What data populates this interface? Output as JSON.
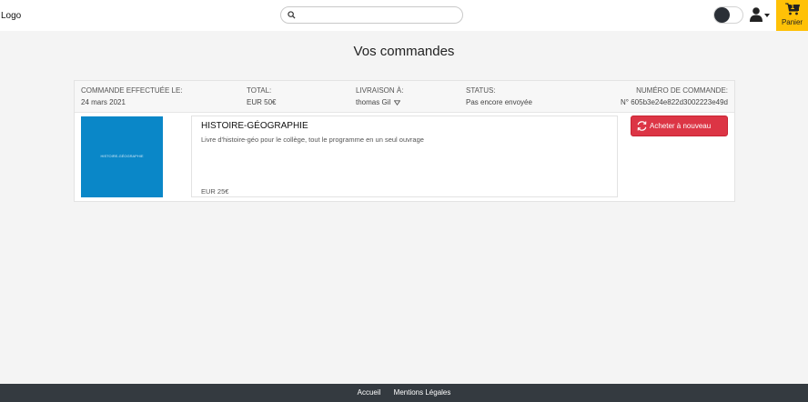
{
  "header": {
    "logo": "Logo",
    "search": {
      "placeholder": "",
      "value": ""
    },
    "cart": {
      "count": "1",
      "label": "Panier"
    }
  },
  "page": {
    "title": "Vos commandes"
  },
  "order": {
    "placed_label": "COMMANDE EFFECTUÉE LE:",
    "placed_value": "24 mars 2021",
    "total_label": "TOTAL:",
    "total_value": "EUR 50€",
    "delivery_label": "LIVRAISON À:",
    "delivery_value": "thomas Gil",
    "status_label": "STATUS:",
    "status_value": "Pas encore envoyée",
    "number_label": "NUMÉRO DE COMMANDE:",
    "number_value": "N° 605b3e24e822d3002223e49d",
    "item": {
      "title": "HISTOIRE-GÉOGRAPHIE",
      "description": "Livre d'histoire-géo pour le collège, tout le programme en un seul ouvrage",
      "price": "EUR 25€",
      "thumb_color": "#0a87c8"
    },
    "rebuy_label": "Acheter à nouveau"
  },
  "footer": {
    "links": [
      "Accueil",
      "Mentions Légales"
    ]
  },
  "colors": {
    "accent": "#ffc107",
    "danger": "#dc3545",
    "footer_bg": "#343a40"
  }
}
